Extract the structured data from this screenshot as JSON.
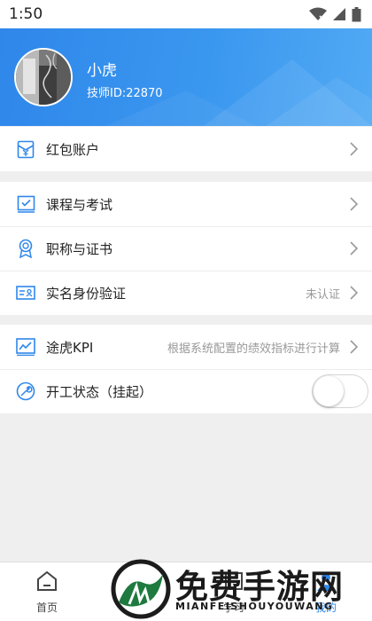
{
  "status_bar": {
    "time": "1:50"
  },
  "profile": {
    "name": "小虎",
    "id_text": "技师ID:22870"
  },
  "sections": [
    {
      "rows": [
        {
          "icon": "red-envelope-icon",
          "label": "红包账户",
          "value": ""
        }
      ]
    },
    {
      "rows": [
        {
          "icon": "course-exam-icon",
          "label": "课程与考试",
          "value": ""
        },
        {
          "icon": "certificate-icon",
          "label": "职称与证书",
          "value": ""
        },
        {
          "icon": "id-card-icon",
          "label": "实名身份验证",
          "value": "未认证"
        }
      ]
    },
    {
      "rows": [
        {
          "icon": "kpi-chart-icon",
          "label": "途虎KPI",
          "value": "根据系统配置的绩效指标进行计算"
        },
        {
          "icon": "wrench-icon",
          "label": "开工状态（挂起）",
          "value": "",
          "toggle_on": false
        }
      ]
    }
  ],
  "tabbar": {
    "tabs": [
      {
        "label": "首页",
        "icon": "home-icon",
        "active": false
      },
      {
        "label": "学习",
        "icon": "study-icon",
        "active": false
      },
      {
        "label": "我的",
        "icon": "profile-icon",
        "active": true
      }
    ]
  },
  "watermark": {
    "title": "免费手游网",
    "subtitle": "MIANFEISHOUYOUWANG"
  },
  "colors": {
    "header_blue": "#2f87ea",
    "icon_blue": "#2f87ea",
    "active_tab": "#2f87ea"
  }
}
